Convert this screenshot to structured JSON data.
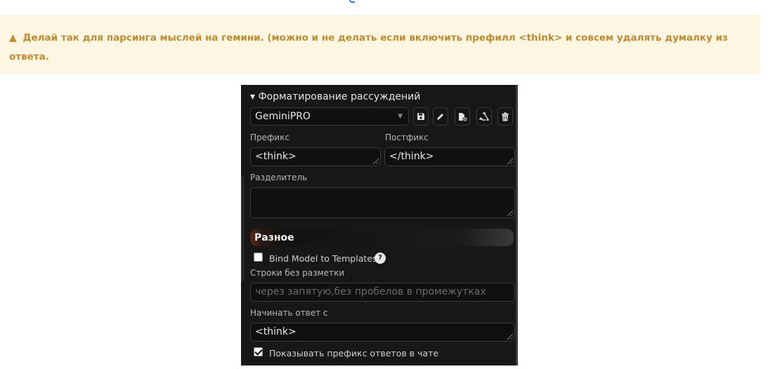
{
  "warning": {
    "icon": "warning-triangle-icon",
    "text": "Делай так для парсинга мыслей на гемини. (можно и не делать если включить префилл <think> и совсем удалять думалку из ответа."
  },
  "reasoning": {
    "section_title": "▾ Форматирование рассуждений",
    "template_selected": "GeminiPRO",
    "buttons": [
      "save-icon",
      "edit-icon",
      "new-file-icon",
      "recycle-icon",
      "trash-icon"
    ],
    "prefix_label": "Префикс",
    "prefix_value": "<think>",
    "postfix_label": "Постфикс",
    "postfix_value": "</think>",
    "separator_label": "Разделитель",
    "separator_value": ""
  },
  "misc": {
    "header": "Разное",
    "bind_model_label": "Bind Model to Templates",
    "bind_model_checked": false,
    "help_glyph": "?",
    "stop_strings_label": "Строки без разметки",
    "stop_strings_placeholder": "через запятую,без пробелов в промежутках",
    "start_reply_label": "Начинать ответ с",
    "start_reply_value": "<think>",
    "show_prefix_label": "Показывать префикс ответов в чате",
    "show_prefix_checked": true
  },
  "colors": {
    "warning_bg": "#fdf6e3",
    "warning_text": "#c38a2a",
    "panel_bg": "#171717"
  }
}
